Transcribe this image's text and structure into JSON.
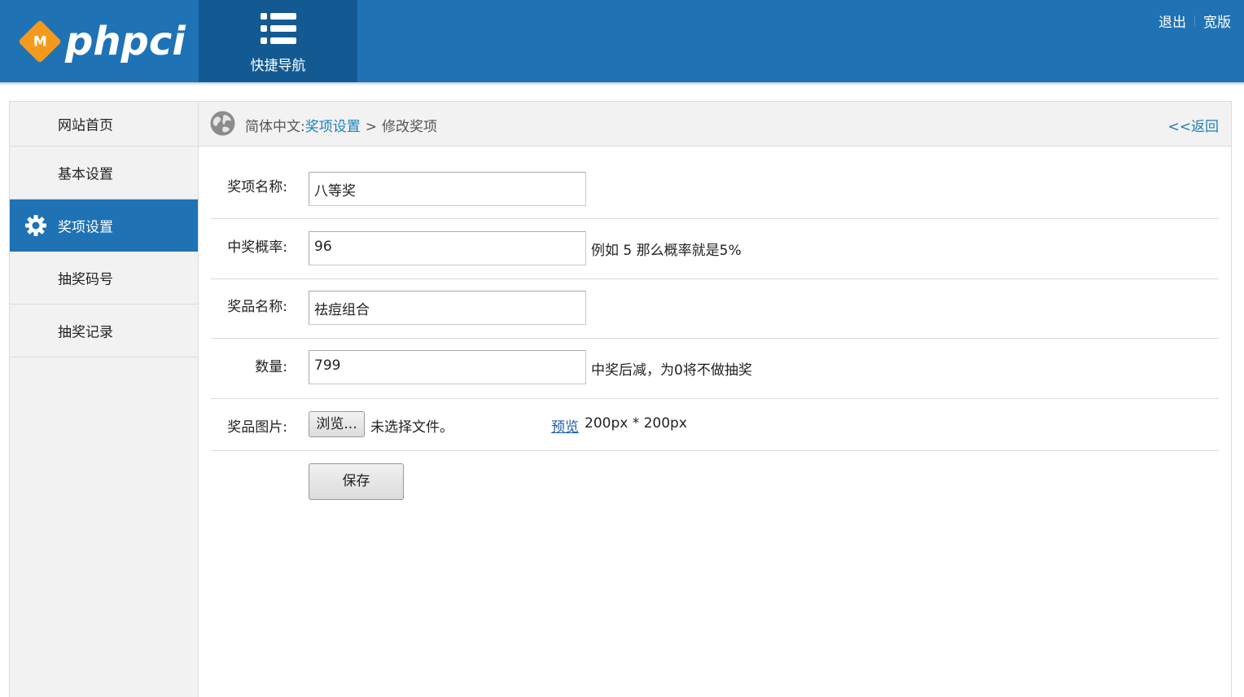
{
  "header": {
    "logo_text": "phpci",
    "logo_badge": "M",
    "quicknav_label": "快捷导航",
    "logout": "退出",
    "widescreen": "宽版",
    "brand_color": "#1f72b4",
    "accent_color": "#f39a1d"
  },
  "sidebar": {
    "items": [
      {
        "label": "网站首页",
        "active": false
      },
      {
        "label": "基本设置",
        "active": false
      },
      {
        "label": "奖项设置",
        "active": true,
        "icon": "gear-icon"
      },
      {
        "label": "抽奖码号",
        "active": false
      },
      {
        "label": "抽奖记录",
        "active": false
      }
    ]
  },
  "breadcrumb": {
    "language": "简体中文:",
    "section": "奖项设置",
    "separator": ">",
    "current": "修改奖项",
    "back": "<<返回"
  },
  "form": {
    "award_name_label": "奖项名称:",
    "award_name_value": "八等奖",
    "probability_label": "中奖概率:",
    "probability_value": "96",
    "probability_hint": "例如 5 那么概率就是5%",
    "prize_name_label": "奖品名称:",
    "prize_name_value": "祛痘组合",
    "quantity_label": "数量:",
    "quantity_value": "799",
    "quantity_hint": "中奖后减，为0将不做抽奖",
    "image_label": "奖品图片:",
    "browse_button": "浏览...",
    "file_status": "未选择文件。",
    "preview_link": "预览",
    "image_size_note": "200px * 200px",
    "save_button": "保存"
  }
}
